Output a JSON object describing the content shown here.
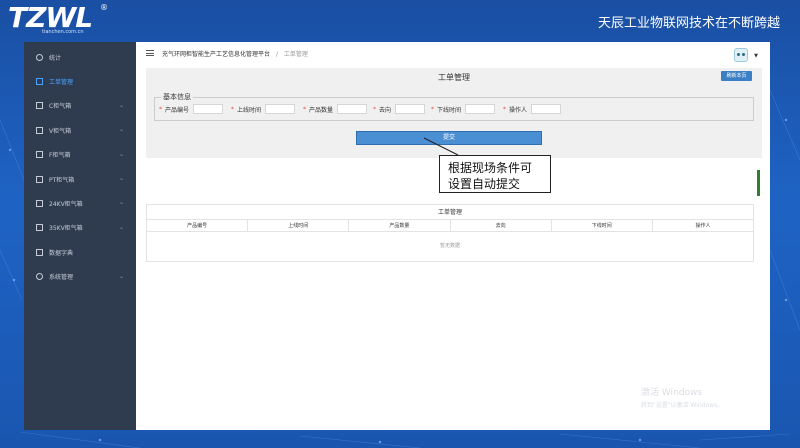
{
  "brand": {
    "logo_text": "TZWL",
    "logo_sub": "tianchen.com.cn",
    "logo_reg": "®",
    "slogan": "天辰工业物联网技术在不断跨越"
  },
  "sidebar": {
    "items": [
      {
        "label": "统计",
        "icon": "home-icon",
        "active": false,
        "has_children": false
      },
      {
        "label": "工单管理",
        "icon": "file-icon",
        "active": true,
        "has_children": false
      },
      {
        "label": "C柜气箱",
        "icon": "box-icon",
        "active": false,
        "has_children": true
      },
      {
        "label": "V柜气箱",
        "icon": "box-icon",
        "active": false,
        "has_children": true
      },
      {
        "label": "F柜气箱",
        "icon": "box-icon",
        "active": false,
        "has_children": true
      },
      {
        "label": "PT柜气箱",
        "icon": "box-icon",
        "active": false,
        "has_children": true
      },
      {
        "label": "24KV柜气箱",
        "icon": "box-icon",
        "active": false,
        "has_children": true
      },
      {
        "label": "35KV柜气箱",
        "icon": "box-icon",
        "active": false,
        "has_children": true
      },
      {
        "label": "数据字典",
        "icon": "dict-icon",
        "active": false,
        "has_children": false
      },
      {
        "label": "系统管理",
        "icon": "gear-icon",
        "active": false,
        "has_children": true
      }
    ]
  },
  "breadcrumb": {
    "root": "充气环网柜智能生产工艺信息化管理平台",
    "separator": "/",
    "current": "工单管理"
  },
  "panel": {
    "title": "工单管理",
    "refresh_label": "刷新本页",
    "legend": "基本信息",
    "fields": [
      {
        "label": "产品编号",
        "value": ""
      },
      {
        "label": "上线时间",
        "value": ""
      },
      {
        "label": "产品数量",
        "value": ""
      },
      {
        "label": "去向",
        "value": ""
      },
      {
        "label": "下线时间",
        "value": ""
      },
      {
        "label": "操作人",
        "value": ""
      }
    ],
    "required_mark": "*",
    "submit_label": "提交"
  },
  "table": {
    "title": "工单管理",
    "columns": [
      "产品编号",
      "上线时间",
      "产品数量",
      "去向",
      "下线时间",
      "操作人"
    ],
    "empty_text": "暂无数据"
  },
  "callout": {
    "line1": "根据现场条件可",
    "line2": "设置自动提交"
  },
  "watermark": {
    "line1": "激活 Windows",
    "line2": "转到\"设置\"以激活 Windows。"
  }
}
